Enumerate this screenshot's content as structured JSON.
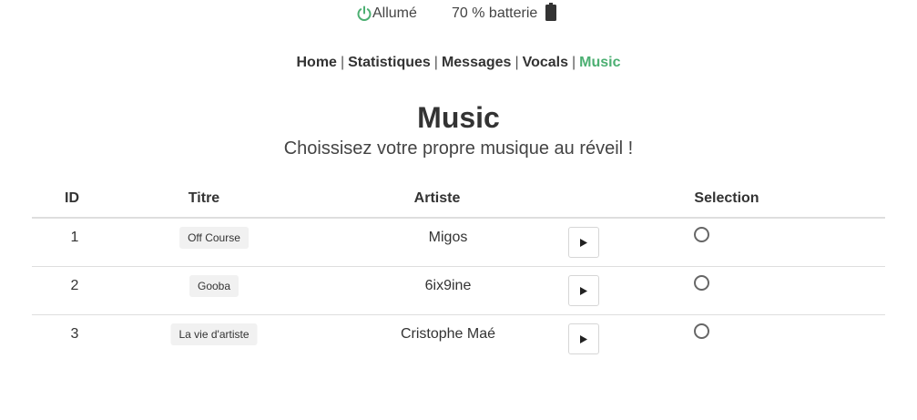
{
  "status": {
    "power_label": "Allumé",
    "battery_label": "70 % batterie",
    "power_icon": "power-icon",
    "battery_icon": "battery-icon",
    "power_color": "#4caf72"
  },
  "nav": {
    "items": [
      {
        "label": "Home"
      },
      {
        "label": "Statistiques"
      },
      {
        "label": "Messages"
      },
      {
        "label": "Vocals"
      },
      {
        "label": "Music"
      }
    ],
    "separator": "|",
    "active": "Music",
    "active_color": "#4caf72"
  },
  "page": {
    "title": "Music",
    "subtitle": "Choissisez votre propre musique au réveil !"
  },
  "table": {
    "headers": {
      "id": "ID",
      "title": "Titre",
      "artist": "Artiste",
      "selection": "Selection"
    },
    "rows": [
      {
        "id": "1",
        "title": "Off Course",
        "artist": "Migos",
        "selected": false
      },
      {
        "id": "2",
        "title": "Gooba",
        "artist": "6ix9ine",
        "selected": false
      },
      {
        "id": "3",
        "title": "La vie d'artiste",
        "artist": "Cristophe Maé",
        "selected": false
      }
    ]
  }
}
